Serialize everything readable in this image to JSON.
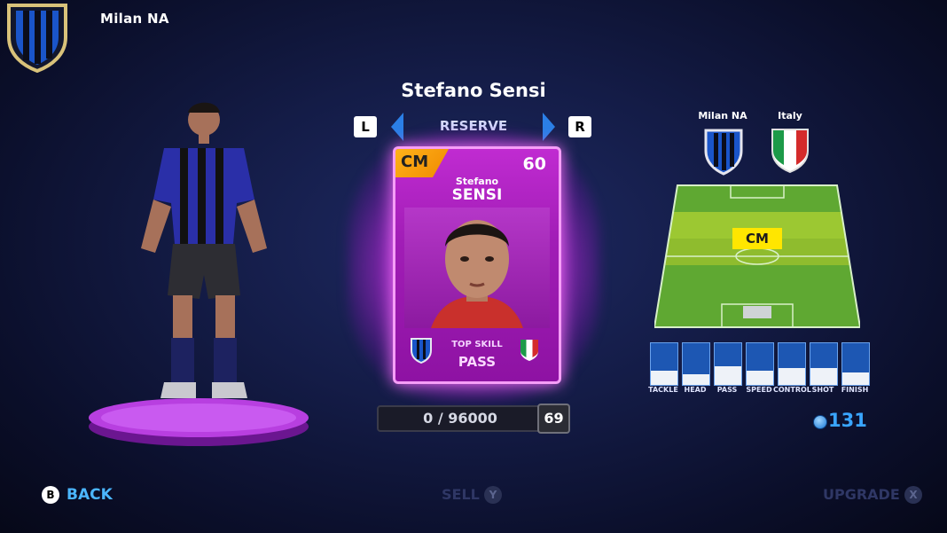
{
  "club": {
    "name": "Milan NA",
    "crest_icon": "club-crest-icon"
  },
  "player": {
    "full_name": "Stefano Sensi",
    "first_name": "Stefano",
    "last_name": "SENSI",
    "position": "CM",
    "rating": "60",
    "status": "RESERVE",
    "top_skill_label": "TOP SKILL",
    "top_skill": "PASS"
  },
  "nav": {
    "left_key": "L",
    "right_key": "R"
  },
  "progress": {
    "xp_text": "0 / 96000",
    "xp_fraction": 0,
    "level": "69"
  },
  "details": {
    "club_label": "Milan NA",
    "nation_label": "Italy",
    "pitch_position": "CM"
  },
  "stats": [
    {
      "label": "TACKLE",
      "value": 0.35
    },
    {
      "label": "HEAD",
      "value": 0.25
    },
    {
      "label": "PASS",
      "value": 0.45
    },
    {
      "label": "SPEED",
      "value": 0.35
    },
    {
      "label": "CONTROL",
      "value": 0.4
    },
    {
      "label": "SHOT",
      "value": 0.4
    },
    {
      "label": "FINISH",
      "value": 0.3
    }
  ],
  "currency": {
    "amount": "131",
    "icon": "coin-icon"
  },
  "prompts": {
    "back_button": "B",
    "back": "BACK",
    "sell": "SELL",
    "sell_button": "Y",
    "upgrade": "UPGRADE",
    "upgrade_button": "X"
  },
  "colors": {
    "accent_blue": "#39a5ff",
    "card_pink": "#c02bd1",
    "position_yellow": "#ffe600"
  }
}
